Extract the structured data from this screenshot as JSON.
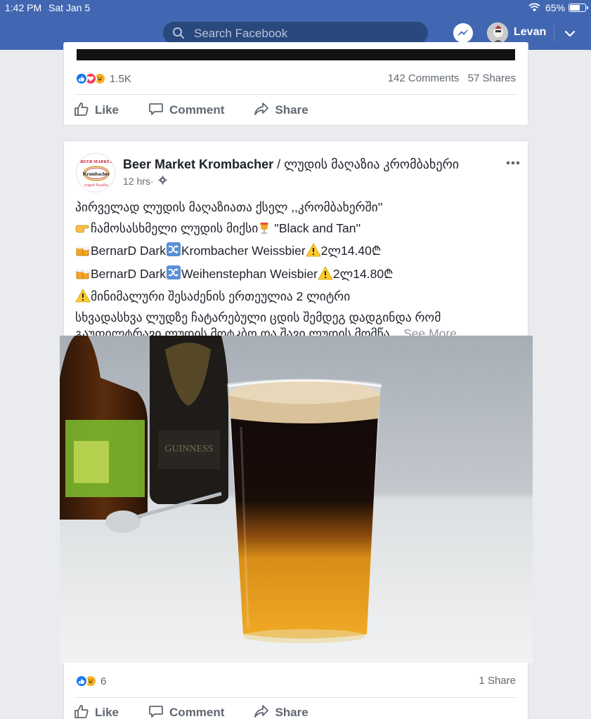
{
  "status_bar": {
    "time": "1:42 PM",
    "date": "Sat Jan 5",
    "battery": "65%",
    "battery_level": 0.65
  },
  "header": {
    "search_placeholder": "Search Facebook",
    "user_name": "Levan",
    "brand_color": "#4267b2"
  },
  "previous_post": {
    "reaction_count": "1.5K",
    "comments": "142 Comments",
    "shares": "57 Shares",
    "reaction_icons": [
      "like-icon",
      "love-icon",
      "haha-icon"
    ]
  },
  "actions": {
    "like": "Like",
    "comment": "Comment",
    "share": "Share"
  },
  "post": {
    "page_name": "Beer Market Krombacher",
    "page_name_suffix": " / ლუდის მაღაზია კრომბახერი",
    "time": "12 hrs",
    "text": {
      "line1": "პირველად ლუდის მაღაზიათა ქსელ ,,კრომბახერში''",
      "line2": "ჩამოსასხმელი ლუდის მიქსი",
      "line2b": " ''Black and Tan''",
      "line3a": "BernarD Dark",
      "line3b": "Krombacher Weissbier",
      "line3c": "2ლ14.40₾",
      "line4a": "BernarD Dark",
      "line4b": "Weihenstephan Weisbier",
      "line4c": "2ლ14.80₾",
      "line5": "მინიმალური შესაძენის ერთეულია 2 ლიტრი",
      "line6": "სხვადასხვა ლუდზე ჩატარებული ცდის შემდეგ დადგინდა რომ",
      "line7": "გაუფილტრავი ლუდის მოტკბო და შავი ლუდის მომწა...",
      "see_more": " See More"
    },
    "reaction_count": "6",
    "shares": "1 Share",
    "reaction_icons": [
      "like-icon",
      "haha-icon"
    ]
  },
  "logo": {
    "top_text": "BEER MARKET",
    "brand": "Krombacher",
    "bottom_text": "ლუდის მაღაზია"
  }
}
